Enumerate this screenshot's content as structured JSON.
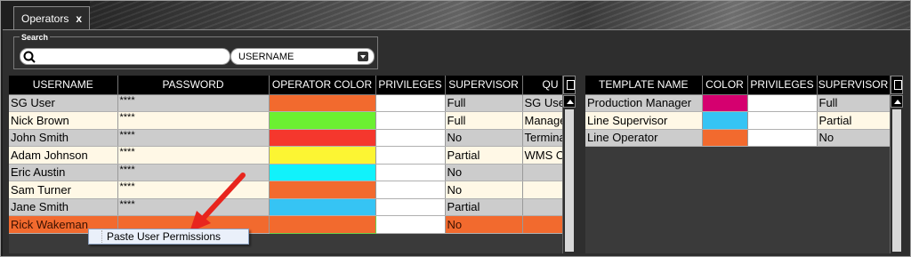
{
  "tab": {
    "label": "Operators",
    "close": "x"
  },
  "search": {
    "label": "Search",
    "input_value": "",
    "field_select": "USERNAME"
  },
  "operators_table": {
    "columns": [
      "USERNAME",
      "PASSWORD",
      "OPERATOR COLOR",
      "PRIVILEGES",
      "SUPERVISOR",
      "QU"
    ],
    "rows": [
      {
        "username": "SG User",
        "password": "****",
        "color": "#f26a2e",
        "supervisor": "Full",
        "qu": "SG User"
      },
      {
        "username": "Nick Brown",
        "password": "****",
        "color": "#6bf031",
        "supervisor": "Full",
        "qu": "Manager"
      },
      {
        "username": "John Smith",
        "password": "****",
        "color": "#f5372d",
        "supervisor": "No",
        "qu": "Terminal"
      },
      {
        "username": "Adam Johnson",
        "password": "****",
        "color": "#fcf533",
        "supervisor": "Partial",
        "qu": "WMS Op"
      },
      {
        "username": "Eric Austin",
        "password": "****",
        "color": "#11f2fb",
        "supervisor": "No",
        "qu": ""
      },
      {
        "username": "Sam Turner",
        "password": "****",
        "color": "#f26a2e",
        "supervisor": "No",
        "qu": ""
      },
      {
        "username": "Jane Smith",
        "password": "****",
        "color": "#36c4f4",
        "supervisor": "Partial",
        "qu": ""
      },
      {
        "username": "Rick Wakeman",
        "password": "",
        "color": "#f26a2e",
        "supervisor": "No",
        "qu": ""
      }
    ]
  },
  "templates_table": {
    "columns": [
      "TEMPLATE NAME",
      "COLOR",
      "PRIVILEGES",
      "SUPERVISOR"
    ],
    "rows": [
      {
        "name": "Production Manager",
        "color": "#d5006f",
        "supervisor": "Full"
      },
      {
        "name": "Line Supervisor",
        "color": "#36c4f4",
        "supervisor": "Partial"
      },
      {
        "name": "Line Operator",
        "color": "#f26a2e",
        "supervisor": "No"
      }
    ]
  },
  "context_menu": {
    "item": "Paste User Permissions"
  },
  "colors": {
    "selected_row": "#f26a2e",
    "arrow": "#e8251d"
  }
}
